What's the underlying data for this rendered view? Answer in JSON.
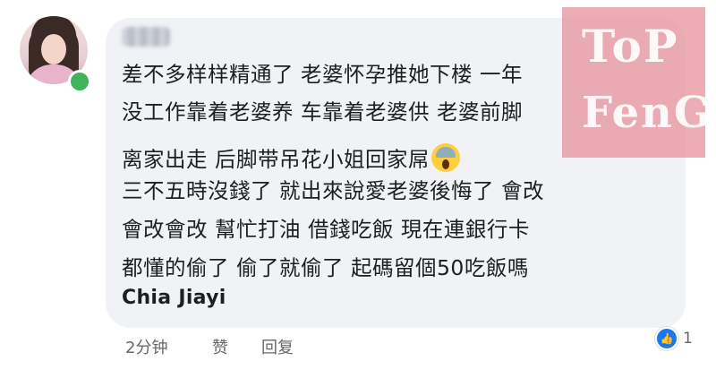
{
  "comment": {
    "lines": [
      "差不多样样精通了 老婆怀孕推她下楼  一年",
      "没工作靠着老婆养 车靠着老婆供  老婆前脚",
      "离家出走 后脚带吊花小姐回家屌",
      "三不五時沒錢了 就出來說愛老婆後悔了 會改",
      "會改會改 幫忙打油 借錢吃飯 現在連銀行卡",
      "都懂的偷了 偷了就偷了 起碼留個50吃飯嗎"
    ],
    "signature": "Chia Jiayi",
    "emoji": "face-screaming-in-fear-icon"
  },
  "watermark": {
    "line1": "ToP",
    "line2": "FenG"
  },
  "actions": {
    "time": "2分钟",
    "like": "赞",
    "reply": "回复"
  },
  "reactions": {
    "count": "1",
    "icon": "thumbs-up-icon"
  },
  "colors": {
    "bubble": "#f1f2f6",
    "online": "#41b35d",
    "like_blue": "#1877f2"
  }
}
